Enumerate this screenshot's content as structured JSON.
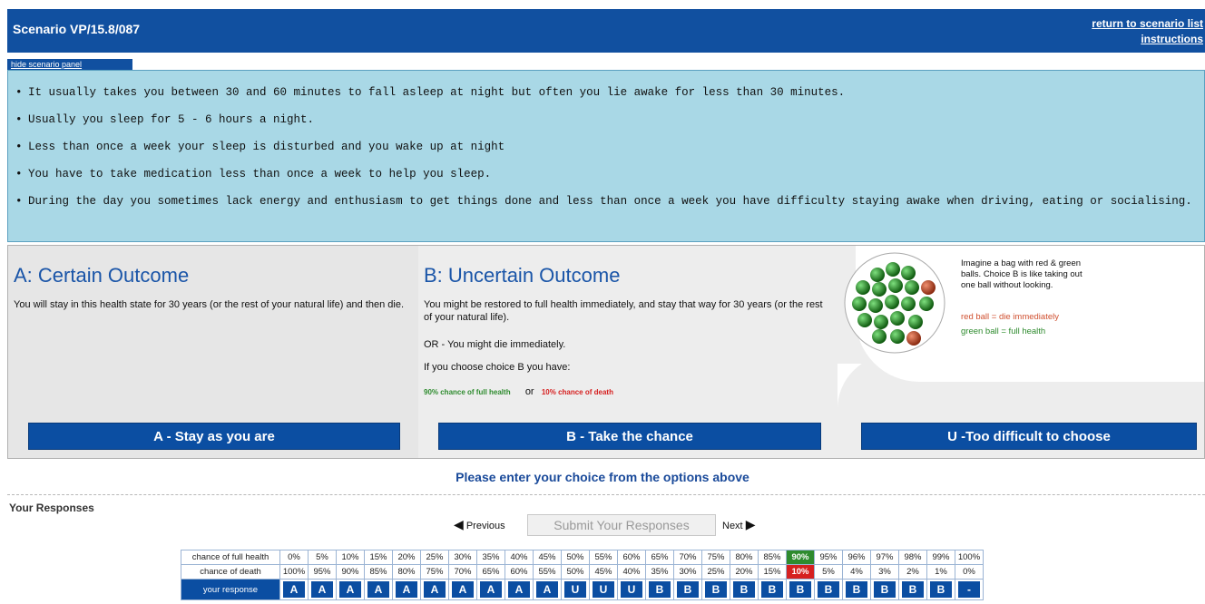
{
  "header": {
    "title": "Scenario VP/15.8/087",
    "return_link": "return to scenario list",
    "instructions_link": "instructions"
  },
  "hide_panel_label": "hide scenario panel",
  "scenario": {
    "bullets": [
      "It usually takes you between 30 and 60 minutes to fall asleep at night but often you lie awake for less than 30 minutes.",
      "Usually you sleep for 5 - 6 hours a night.",
      "Less than once a week your sleep is disturbed and you wake up at night",
      "You have to take medication less than once a week to help you sleep.",
      "During the day you sometimes lack energy and enthusiasm to get things done and less than once a week you have difficulty staying awake when driving, eating or socialising."
    ]
  },
  "choice_a": {
    "title": "A: Certain Outcome",
    "text": "You will stay in this health state for 30 years (or the rest of your natural life) and then die.",
    "button": "A - Stay as you are"
  },
  "choice_b": {
    "title": "B: Uncertain Outcome",
    "text": "You might be restored to full health immediately, and stay that way for 30 years (or the rest of your natural life).",
    "or_text": "OR - You might die immediately.",
    "if_text": "If you choose choice B you have:",
    "full_health": "90% chance of full health",
    "or_word": "or",
    "death": "10% chance of death",
    "button": "B - Take the chance"
  },
  "choice_u": {
    "bag_text": "Imagine a bag with red & green balls. Choice B is like taking out one ball without looking.",
    "red_legend": "red ball = die immediately",
    "green_legend": "green ball = full health",
    "button": "U -Too difficult to choose"
  },
  "colors": {
    "accent": "#0b4ea2",
    "green": "#2e8b2e",
    "red": "#d62020",
    "scenario_bg": "#a9d8e6"
  },
  "prompt": "Please enter your choice from the options above",
  "your_responses": "Your Responses",
  "nav": {
    "previous": "Previous",
    "submit": "Submit Your Responses",
    "next": "Next"
  },
  "table": {
    "row_labels": [
      "chance of full health",
      "chance of death",
      "your response"
    ],
    "full_health": [
      "0%",
      "5%",
      "10%",
      "15%",
      "20%",
      "25%",
      "30%",
      "35%",
      "40%",
      "45%",
      "50%",
      "55%",
      "60%",
      "65%",
      "70%",
      "75%",
      "80%",
      "85%",
      "90%",
      "95%",
      "96%",
      "97%",
      "98%",
      "99%",
      "100%"
    ],
    "death": [
      "100%",
      "95%",
      "90%",
      "85%",
      "80%",
      "75%",
      "70%",
      "65%",
      "60%",
      "55%",
      "50%",
      "45%",
      "40%",
      "35%",
      "30%",
      "25%",
      "20%",
      "15%",
      "10%",
      "5%",
      "4%",
      "3%",
      "2%",
      "1%",
      "0%"
    ],
    "responses": [
      "A",
      "A",
      "A",
      "A",
      "A",
      "A",
      "A",
      "A",
      "A",
      "A",
      "U",
      "U",
      "U",
      "B",
      "B",
      "B",
      "B",
      "B",
      "B",
      "B",
      "B",
      "B",
      "B",
      "B",
      "-"
    ],
    "selected_index": 18
  }
}
